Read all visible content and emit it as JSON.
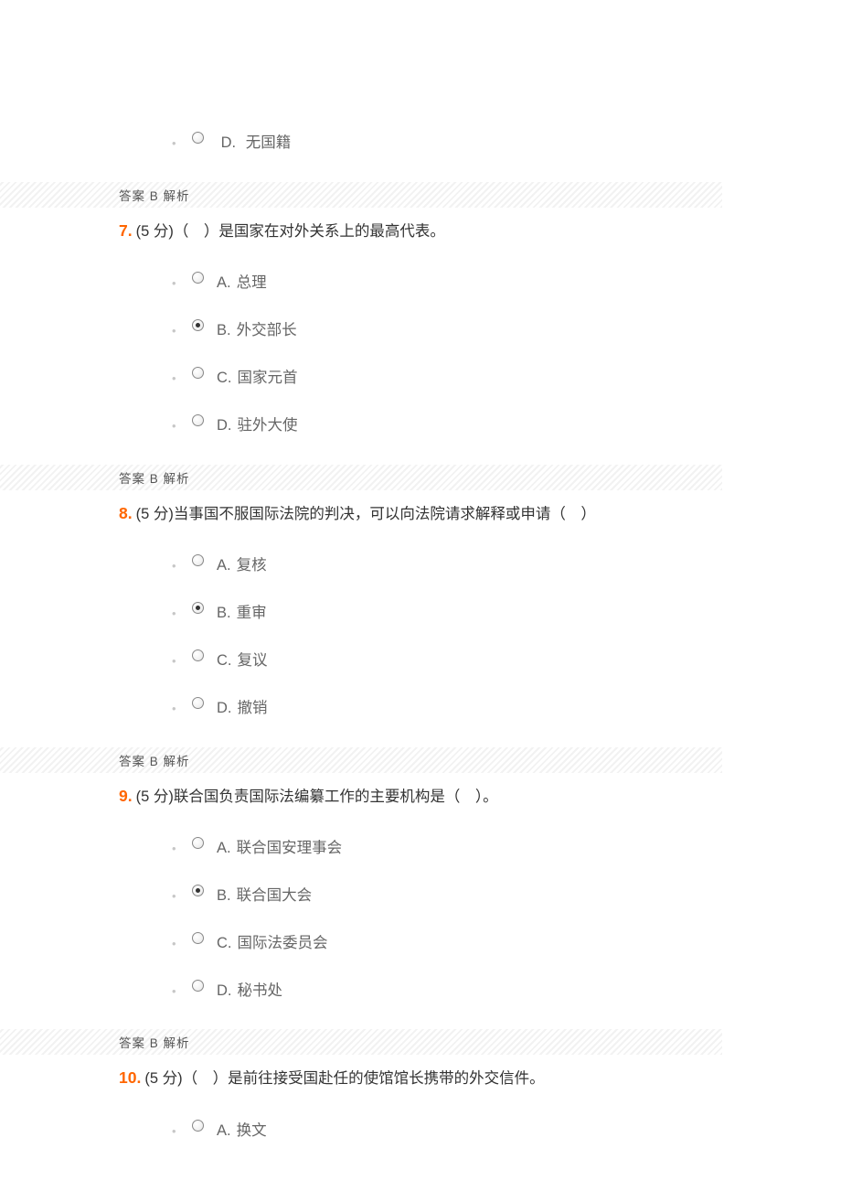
{
  "orphan_option": {
    "letter": "D.",
    "text": "无国籍",
    "selected": false
  },
  "orphan_answer": "答案 B  解析",
  "questions": [
    {
      "num": "7.",
      "points": "(5 分)",
      "text": "（　）是国家在对外关系上的最高代表。",
      "options": [
        {
          "letter": "A.",
          "text": "总理",
          "selected": false
        },
        {
          "letter": "B.",
          "text": "外交部长",
          "selected": true
        },
        {
          "letter": "C.",
          "text": "国家元首",
          "selected": false
        },
        {
          "letter": "D.",
          "text": "驻外大使",
          "selected": false
        }
      ],
      "answer": "答案 B  解析"
    },
    {
      "num": "8.",
      "points": "(5 分)",
      "text": "当事国不服国际法院的判决，可以向法院请求解释或申请（　）",
      "options": [
        {
          "letter": "A.",
          "text": "复核",
          "selected": false
        },
        {
          "letter": "B.",
          "text": "重审",
          "selected": true
        },
        {
          "letter": "C.",
          "text": "复议",
          "selected": false
        },
        {
          "letter": "D.",
          "text": "撤销",
          "selected": false
        }
      ],
      "answer": "答案 B  解析"
    },
    {
      "num": "9.",
      "points": "(5 分)",
      "text": "联合国负责国际法编纂工作的主要机构是（　）。",
      "options": [
        {
          "letter": "A.",
          "text": "联合国安理事会",
          "selected": false
        },
        {
          "letter": "B.",
          "text": "联合国大会",
          "selected": true
        },
        {
          "letter": "C.",
          "text": "国际法委员会",
          "selected": false
        },
        {
          "letter": "D.",
          "text": "秘书处",
          "selected": false
        }
      ],
      "answer": "答案 B  解析"
    },
    {
      "num": "10.",
      "points": "(5 分)",
      "text": "（　）是前往接受国赴任的使馆馆长携带的外交信件。",
      "options": [
        {
          "letter": "A.",
          "text": "换文",
          "selected": false
        }
      ],
      "answer": null
    }
  ]
}
